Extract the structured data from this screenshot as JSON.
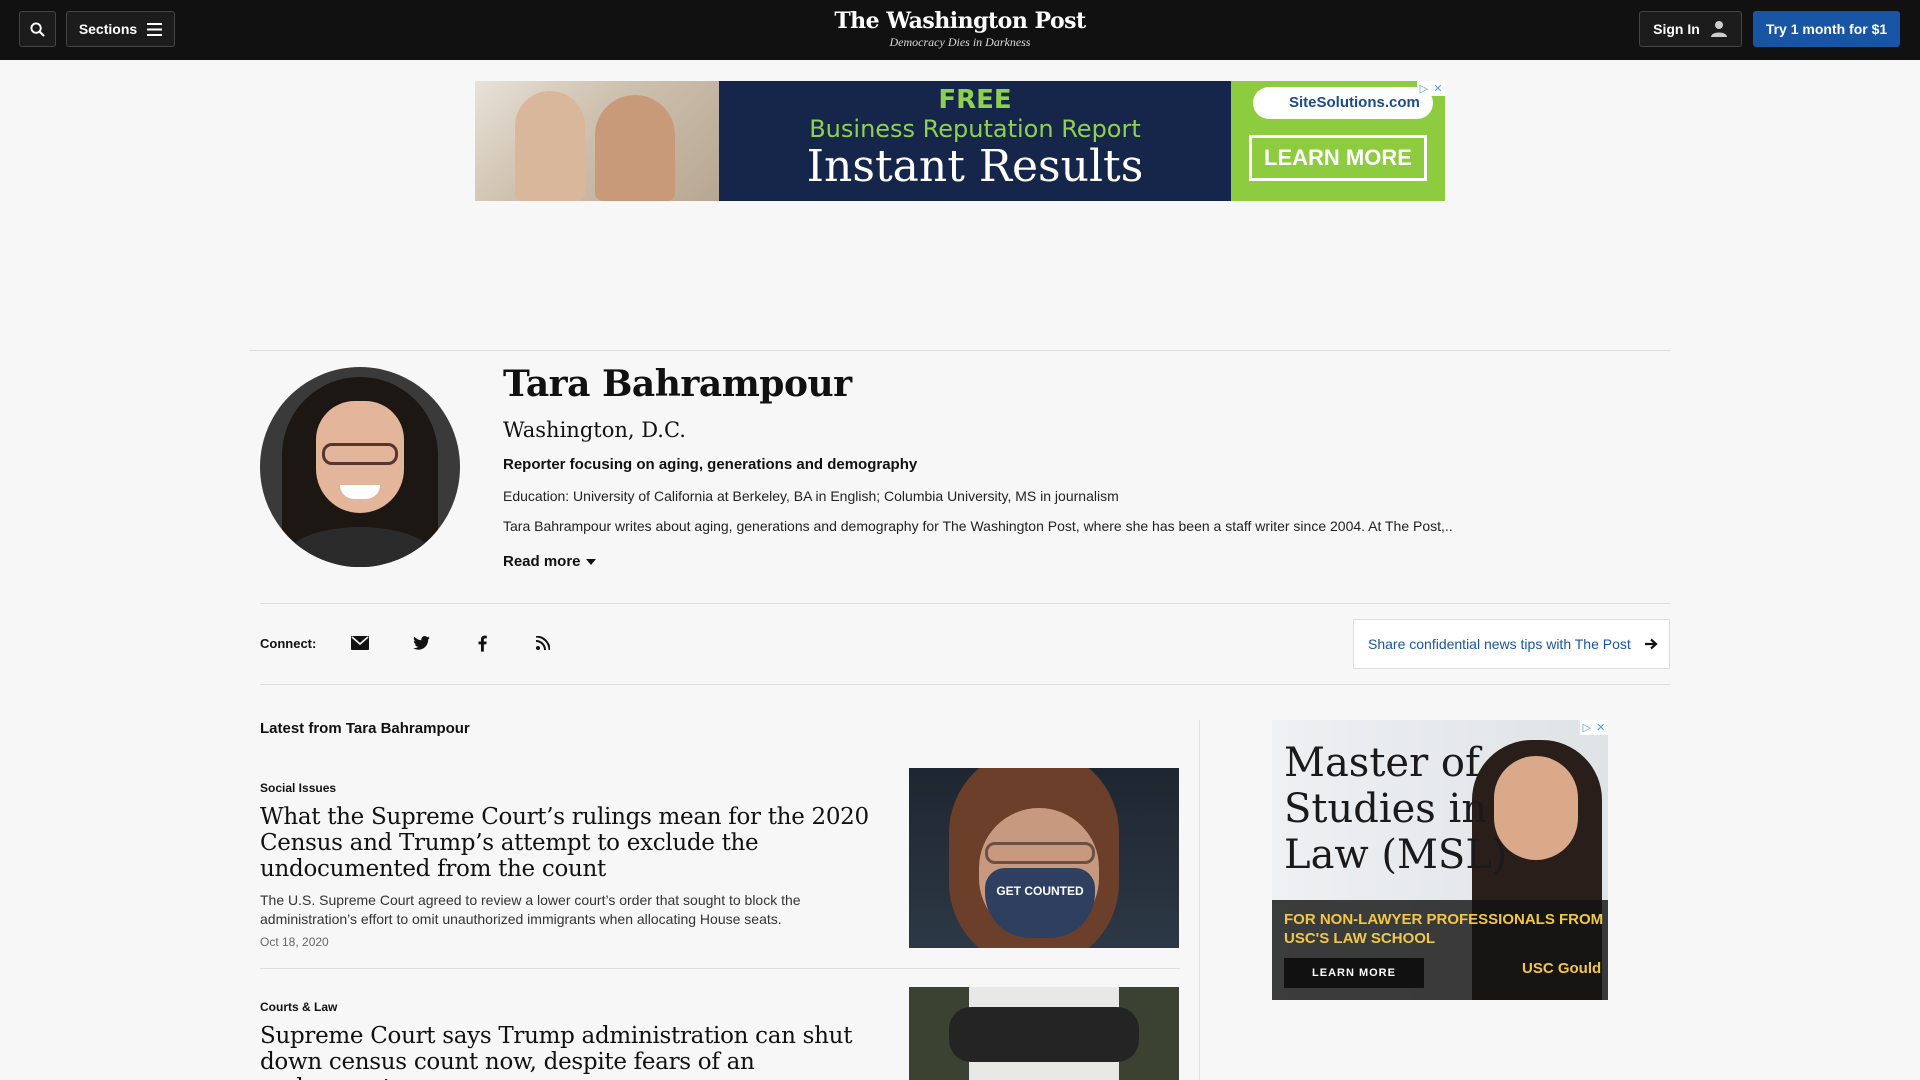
{
  "header": {
    "sections_label": "Sections",
    "logo_title": "The Washington Post",
    "logo_tagline": "Democracy Dies in Darkness",
    "signin_label": "Sign In",
    "try_label": "Try 1 month for $1"
  },
  "ads": {
    "top": {
      "line1": "FREE",
      "line2": "Business Reputation Report",
      "line3": "Instant Results",
      "brand": "SiteSolutions.com",
      "cta": "LEARN MORE"
    },
    "side": {
      "headline": "Master of Studies in Law (MSL)",
      "sub": "FOR NON-LAWYER PROFESSIONALS FROM USC'S LAW SCHOOL",
      "cta": "LEARN MORE",
      "brand": "USC Gould"
    }
  },
  "profile": {
    "name": "Tara Bahrampour",
    "location": "Washington, D.C.",
    "role": "Reporter focusing on aging, generations and demography",
    "education": "Education: University of California at Berkeley, BA in English; Columbia University, MS in journalism",
    "bio": "Tara Bahrampour writes about aging, generations and demography for The Washington Post, where she has been a staff writer since 2004. At The Post,...",
    "read_more": "Read more"
  },
  "connect": {
    "label": "Connect:",
    "icons": [
      "envelope-icon",
      "twitter-icon",
      "facebook-icon",
      "rss-icon"
    ],
    "tips_label": "Share confidential news tips with The Post"
  },
  "latest": {
    "title": "Latest from Tara Bahrampour",
    "stories": [
      {
        "kicker": "Social Issues",
        "headline": "What the Supreme Court’s rulings mean for the 2020 Census and Trump’s attempt to exclude the undocumented from the count",
        "blurb": "The U.S. Supreme Court agreed to review a lower court’s order that sought to block the administration’s effort to omit unauthorized immigrants when allocating House seats.",
        "date": "Oct 18, 2020",
        "image_text": "GET COUNTED"
      },
      {
        "kicker": "Courts & Law",
        "headline": "Supreme Court says Trump administration can shut down census count now, despite fears of an undercount"
      }
    ]
  },
  "colors": {
    "nav_bg": "#111111",
    "accent": "#1955a5",
    "page_bg": "#f7f7f7"
  }
}
